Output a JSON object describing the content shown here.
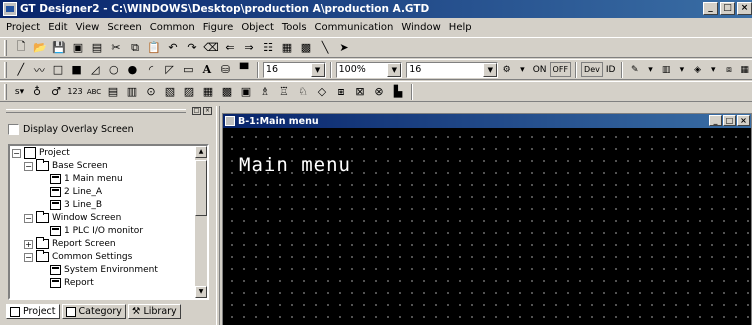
{
  "window": {
    "title": "GT Designer2 - C:\\WINDOWS\\Desktop\\production A\\production A.GTD",
    "minimize": "_",
    "maximize": "□",
    "close": "×"
  },
  "menu": [
    "Project",
    "Edit",
    "View",
    "Screen",
    "Common",
    "Figure",
    "Object",
    "Tools",
    "Communication",
    "Window",
    "Help"
  ],
  "toolbar": {
    "font_size": "16",
    "zoom": "100%",
    "grid": "16",
    "on_label": "ON",
    "off_label": "OFF",
    "dev_label": "Dev",
    "id_label": "ID"
  },
  "left_panel": {
    "display_overlay": "Display Overlay Screen",
    "tree": [
      {
        "label": "Project"
      },
      {
        "label": "Base Screen"
      },
      {
        "label": "1 Main menu"
      },
      {
        "label": "2 Line_A"
      },
      {
        "label": "3 Line_B"
      },
      {
        "label": "Window Screen"
      },
      {
        "label": "1 PLC I/O monitor"
      },
      {
        "label": "Report Screen"
      },
      {
        "label": "Common Settings"
      },
      {
        "label": "System Environment"
      },
      {
        "label": "Report"
      }
    ],
    "tabs": [
      "Project",
      "Category",
      "Library"
    ]
  },
  "child_window": {
    "title": "B-1:Main menu",
    "screen_text": "Main menu"
  }
}
